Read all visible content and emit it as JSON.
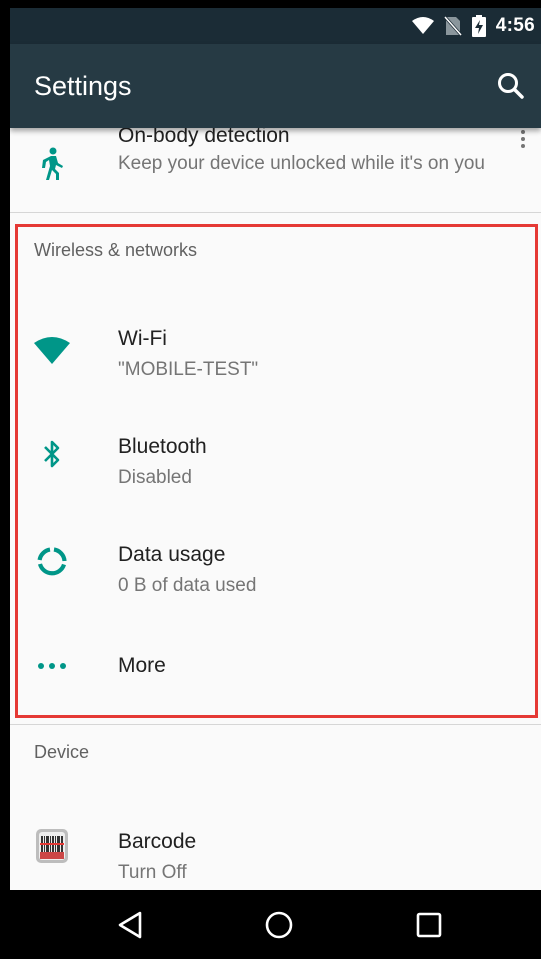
{
  "status_bar": {
    "time": "4:56",
    "icons": [
      "wifi-icon",
      "no-sim-icon",
      "battery-charging-icon"
    ]
  },
  "app_bar": {
    "title": "Settings",
    "search_icon": "search-icon"
  },
  "list": {
    "on_body": {
      "title": "On-body detection",
      "subtitle": "Keep your device unlocked while it's on you",
      "icon": "walking-person-icon"
    },
    "wireless_header": "Wireless & networks",
    "wifi": {
      "title": "Wi-Fi",
      "subtitle": "\"MOBILE-TEST\"",
      "icon": "wifi-icon"
    },
    "bluetooth": {
      "title": "Bluetooth",
      "subtitle": "Disabled",
      "icon": "bluetooth-icon"
    },
    "data_usage": {
      "title": "Data usage",
      "subtitle": "0 B of data used",
      "icon": "data-usage-icon"
    },
    "more": {
      "title": "More",
      "icon": "more-horizontal-icon"
    },
    "device_header": "Device",
    "barcode": {
      "title": "Barcode",
      "subtitle": "Turn Off",
      "icon": "barcode-scanner-icon"
    }
  },
  "nav_bar": {
    "back": "back-icon",
    "home": "home-icon",
    "recents": "recents-icon"
  },
  "colors": {
    "accent": "#009688",
    "app_bar": "#263a44",
    "status_bar": "#1b2c36",
    "highlight": "#e53935"
  }
}
